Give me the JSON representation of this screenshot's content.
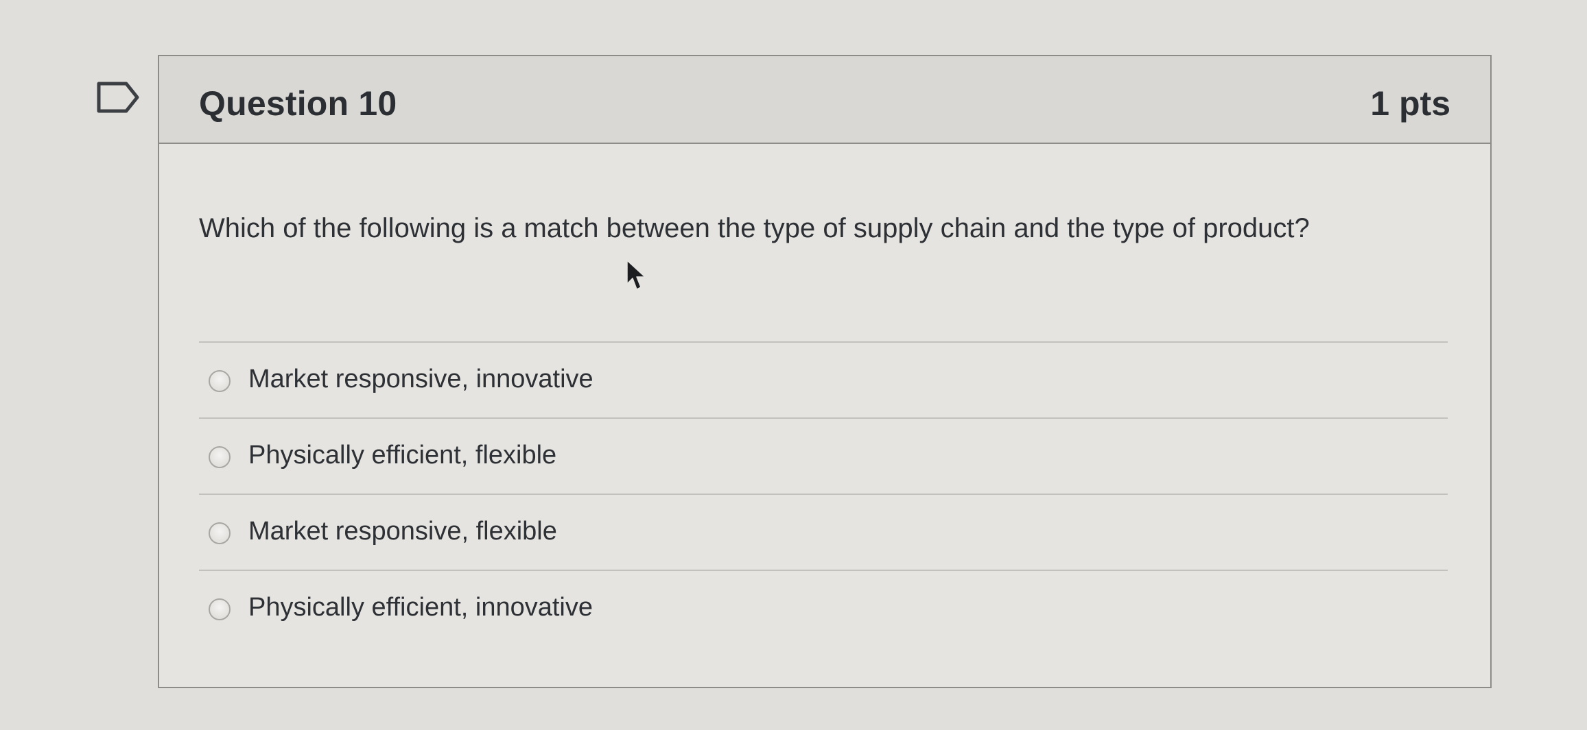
{
  "question": {
    "title": "Question 10",
    "points": "1 pts",
    "text": "Which of the following is a match between the type of supply chain and the type of product?",
    "flag_icon": "flag-outline-icon"
  },
  "answers": [
    {
      "label": "Market responsive, innovative"
    },
    {
      "label": "Physically efficient, flexible"
    },
    {
      "label": "Market responsive, flexible"
    },
    {
      "label": "Physically efficient, innovative"
    }
  ],
  "colors": {
    "background": "#e1dfdb",
    "card": "#e6e4e0",
    "header": "#dad8d4",
    "border": "#8e8c89",
    "text": "#2d3035"
  }
}
